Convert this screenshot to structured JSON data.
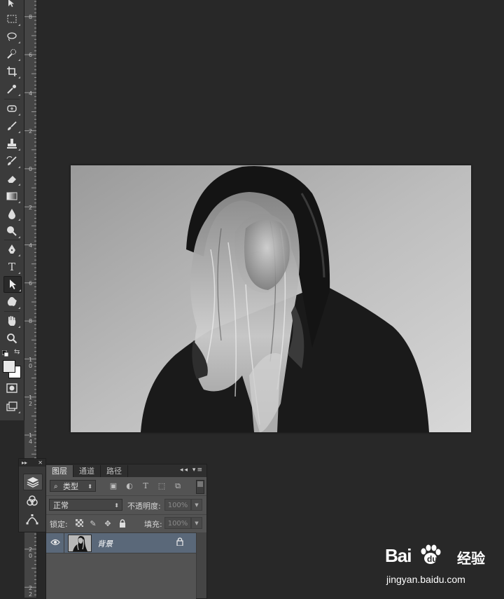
{
  "toolbar": {
    "tools": [
      {
        "name": "move-tool",
        "icon": "move-icon"
      },
      {
        "name": "marquee-tool",
        "icon": "marquee-icon"
      },
      {
        "name": "lasso-tool",
        "icon": "lasso-icon"
      },
      {
        "name": "quick-select-tool",
        "icon": "quick-select-icon"
      },
      {
        "name": "crop-tool",
        "icon": "crop-icon"
      },
      {
        "name": "eyedropper-tool",
        "icon": "eyedropper-icon"
      },
      {
        "name": "healing-brush-tool",
        "icon": "healing-icon"
      },
      {
        "name": "brush-tool",
        "icon": "brush-icon"
      },
      {
        "name": "clone-stamp-tool",
        "icon": "stamp-icon"
      },
      {
        "name": "history-brush-tool",
        "icon": "history-brush-icon"
      },
      {
        "name": "eraser-tool",
        "icon": "eraser-icon"
      },
      {
        "name": "gradient-tool",
        "icon": "gradient-icon"
      },
      {
        "name": "blur-tool",
        "icon": "blur-icon"
      },
      {
        "name": "dodge-tool",
        "icon": "dodge-icon"
      },
      {
        "name": "pen-tool",
        "icon": "pen-icon"
      },
      {
        "name": "type-tool",
        "icon": "type-icon",
        "glyph": "T"
      },
      {
        "name": "path-selection-tool",
        "icon": "path-select-icon"
      },
      {
        "name": "custom-shape-tool",
        "icon": "shape-icon"
      },
      {
        "name": "hand-tool",
        "icon": "hand-icon"
      },
      {
        "name": "zoom-tool",
        "icon": "zoom-icon"
      }
    ],
    "active_tool": "path-selection-tool",
    "foreground_color": "#e8e8e8",
    "background_color": "#ffffff"
  },
  "ruler": {
    "labels": [
      "8",
      "6",
      "4",
      "2",
      "0",
      "2",
      "4",
      "6",
      "8",
      "1\n0",
      "1\n2",
      "1\n4",
      "1\n6",
      "1\n8",
      "2\n0",
      "2\n2"
    ]
  },
  "layers_panel": {
    "tabs": [
      "图层",
      "通道",
      "路径"
    ],
    "active_tab": "图层",
    "filter_kind": "类型",
    "blend_mode": "正常",
    "opacity_label": "不透明度:",
    "opacity_value": "100%",
    "lock_label": "锁定:",
    "fill_label": "填充:",
    "fill_value": "100%",
    "layers": [
      {
        "name": "背景",
        "visible": true,
        "locked": true,
        "selected": true
      }
    ]
  },
  "watermark": {
    "brand": "Bai",
    "brand2": "经验",
    "url": "jingyan.baidu.com"
  },
  "colors": {
    "workspace": "#282828",
    "panel": "#535353",
    "selected_layer": "#5a6879"
  }
}
